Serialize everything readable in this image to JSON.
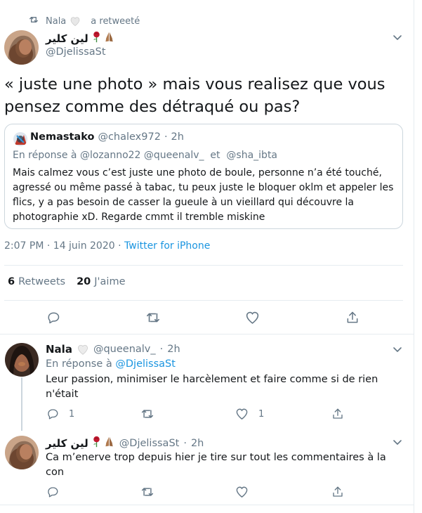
{
  "retweet_line": {
    "text": "Nala 🤍 a retweeté",
    "name": "Nala",
    "suffix": "a retweeté"
  },
  "tweet": {
    "author_name": "لين كلير",
    "author_emojis": [
      "rose",
      "folded-hands"
    ],
    "handle": "@DjelissaSt",
    "text": "«  juste une photo » mais vous realisez que vous pensez comme des détraqué ou pas?",
    "quote": {
      "author_name": "Nemastako",
      "handle": "@chalex972",
      "separator": "·",
      "time": "2h",
      "reply_to": "En réponse à @lozanno22 @queenalv_  et  @sha_ibta",
      "text": "Mais calmez vous c’est juste une photo de boule, personne n’a été touché, agressé ou même passé à tabac, tu peux juste le bloquer oklm et appeler les flics, y a pas besoin de casser la gueule à un vieillard qui découvre la photographie xD. Regarde cmmt il tremble miskine"
    },
    "time": "2:07 PM",
    "date": "14 juin 2020",
    "source": "Twitter for iPhone",
    "separator": "·",
    "stats": {
      "retweets_count": "6",
      "retweets_label": "Retweets",
      "likes_count": "20",
      "likes_label": "J'aime"
    }
  },
  "replies": [
    {
      "author_name": "Nala",
      "handle": "@queenalv_",
      "separator": "·",
      "time": "2h",
      "reply_prefix": "En réponse à",
      "reply_to": "@DjelissaSt",
      "text": "Leur passion, minimiser le harcèlement et faire comme si de rien n'était",
      "reply_count": "1",
      "like_count": "1"
    },
    {
      "author_name": "لين كلير",
      "handle": "@DjelissaSt",
      "separator": "·",
      "time": "2h",
      "text": "Ca m’enerve trop depuis hier je tire sur tout les commentaires à la con"
    }
  ],
  "colors": {
    "text": "#14171a",
    "secondary": "#657786",
    "link": "#1b95e0",
    "border": "#e6ecf0",
    "card_border": "#ccd6dd"
  }
}
